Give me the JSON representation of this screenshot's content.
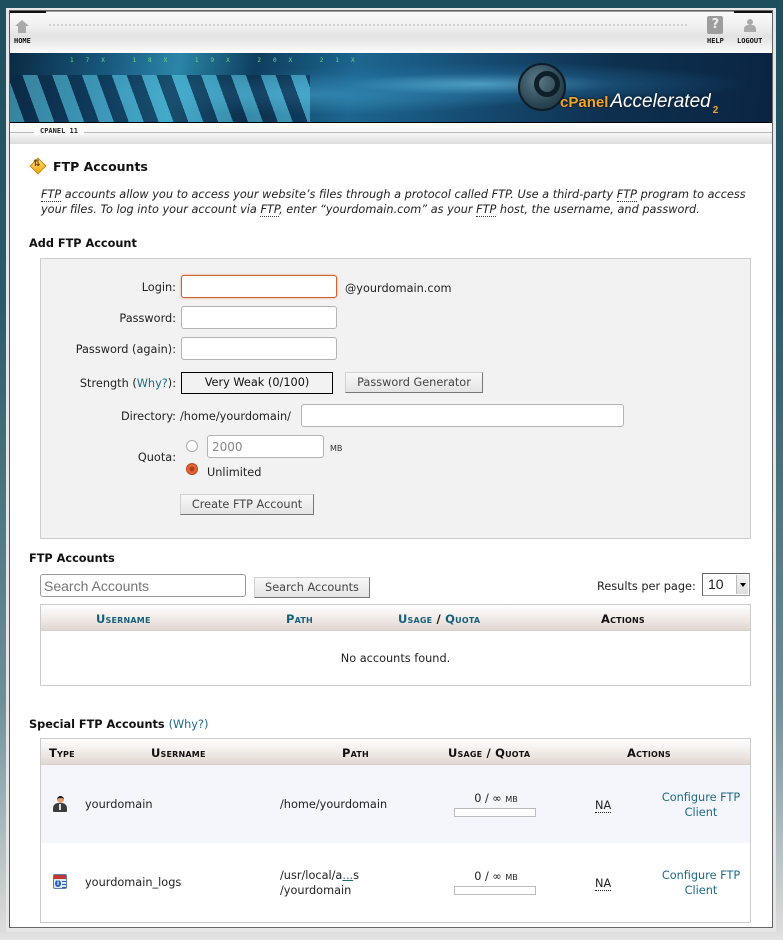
{
  "topnav": {
    "home_label": "HOME",
    "help_label": "HELP",
    "logout_label": "LOGOUT",
    "icons": {
      "home": "home-icon",
      "help": "help-icon",
      "logout": "logout-icon"
    }
  },
  "banner": {
    "brand_cpanel": "cPanel",
    "brand_accelerated": "Accelerated",
    "brand_version": "2",
    "port_labels": "17X 18X 19X 20X 21X"
  },
  "version_label": "CPANEL 11",
  "page": {
    "title": "FTP Accounts",
    "icon": "ftp-accounts-icon",
    "description": {
      "p1_abbr1": "FTP",
      "p1_text1": " accounts allow you to access your website’s files through a protocol called FTP. Use a third-party ",
      "p1_abbr2": "FTP",
      "p1_text2": " program to access your files. To log into your account via ",
      "p1_abbr3": "FTP",
      "p1_text3": ", enter “yourdomain.com” as your ",
      "p1_abbr4": "FTP",
      "p1_text4": " host, the username, and password."
    }
  },
  "add_account": {
    "title": "Add FTP Account",
    "login_label": "Login:",
    "login_value": "",
    "domain_suffix": "@yourdomain.com",
    "password_label": "Password:",
    "password_value": "",
    "password_again_label": "Password (again):",
    "password_again_value": "",
    "strength_label_prefix": "Strength (",
    "strength_why": "Why?",
    "strength_label_suffix": "):",
    "strength_value": "Very Weak (0/100)",
    "strength_score": 0,
    "password_generator_button": "Password Generator",
    "directory_label": "Directory:",
    "directory_prefix": "/home/yourdomain/",
    "directory_value": "",
    "quota_label": "Quota:",
    "quota_value": "2000",
    "quota_unit": "MB",
    "quota_limited_selected": false,
    "quota_unlimited_label": "Unlimited",
    "quota_unlimited_selected": true,
    "create_button": "Create FTP Account"
  },
  "ftp_accounts": {
    "title": "FTP Accounts",
    "search_placeholder": "Search Accounts",
    "search_value": "",
    "search_button": "Search Accounts",
    "results_per_page_label": "Results per page:",
    "results_per_page_value": "10",
    "columns": {
      "username": "Username",
      "path": "Path",
      "usage": "Usage",
      "slash": " / ",
      "quota": "Quota",
      "actions": "Actions"
    },
    "empty_message": "No accounts found."
  },
  "special_accounts": {
    "title": "Special FTP Accounts",
    "why_link": "(Why?)",
    "columns": {
      "type": "Type",
      "username": "Username",
      "path": "Path",
      "usage_quota": "Usage / Quota",
      "actions": "Actions"
    },
    "rows": [
      {
        "type_icon": "user-account-icon",
        "username": "yourdomain",
        "path_line1": "/home/yourdomain",
        "path_line2": "",
        "usage": "0 / ∞",
        "usage_unit": "MB",
        "usage_fraction": 0,
        "na": "NA",
        "action_line1": "Configure FTP",
        "action_line2": "Client"
      },
      {
        "type_icon": "logs-account-icon",
        "username": "yourdomain_logs",
        "path_line1": "/usr/local/a",
        "path_ellipsis": "...",
        "path_line1_end": "s",
        "path_line2": "/yourdomain",
        "usage": "0 / ∞",
        "usage_unit": "MB",
        "usage_fraction": 0,
        "na": "NA",
        "action_line1": "Configure FTP",
        "action_line2": "Client"
      }
    ]
  },
  "colors": {
    "link": "#1d6a86",
    "header_sortable": "#17607b",
    "focus_border": "#d4622f",
    "brand_orange": "#f5a623"
  }
}
